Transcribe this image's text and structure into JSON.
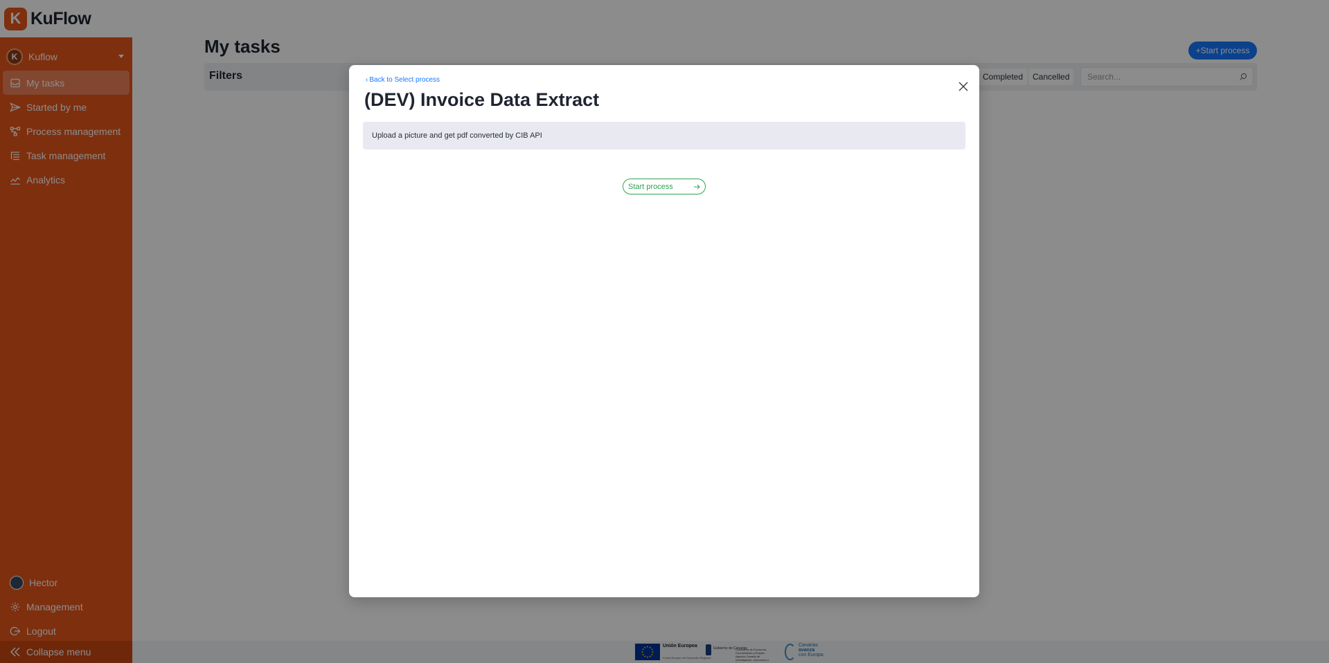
{
  "app": {
    "brand": "KuFlow",
    "logo_letter": "K",
    "accent": "#e5561a"
  },
  "workspace": {
    "name": "Kuflow",
    "avatar_letter": "K"
  },
  "nav": [
    {
      "label": "My tasks",
      "icon": "inbox-icon",
      "active": true
    },
    {
      "label": "Started by me",
      "icon": "send-icon",
      "active": false
    },
    {
      "label": "Process management",
      "icon": "flow-icon",
      "active": false
    },
    {
      "label": "Task management",
      "icon": "list-icon",
      "active": false
    },
    {
      "label": "Analytics",
      "icon": "chart-line-icon",
      "active": false
    }
  ],
  "bottom_nav": {
    "user": "Hector",
    "management": "Management",
    "logout": "Logout",
    "collapse": "Collapse menu"
  },
  "main": {
    "title": "My tasks",
    "start_button": "Start process",
    "filters_label": "Filters",
    "tabs": [
      "Completed",
      "Cancelled"
    ],
    "search_placeholder": "Search..."
  },
  "footer": {
    "eu_label": "Unión Europea",
    "eu_sub": "Fondo Europeo de Desarrollo Regional",
    "gov_label": "Gobierno de Canarias",
    "gov_sub": "Consejería de Economía, Conocimiento y Empleo Agencia Canaria de Investigación, Innovación y Sociedad de la Información",
    "canarias": [
      "Canarias",
      "avanza",
      "con Europa"
    ]
  },
  "modal": {
    "back_link": "Back to Select process",
    "title": "(DEV) Invoice Data Extract",
    "description": "Upload a picture and get pdf converted by CIB API",
    "start_button": "Start process"
  }
}
